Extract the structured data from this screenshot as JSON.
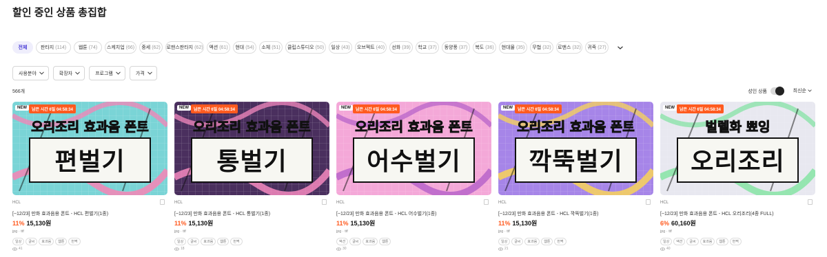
{
  "page": {
    "title": "할인 중인 상품 총집합"
  },
  "categories": [
    {
      "label": "전체",
      "count": "",
      "active": true
    },
    {
      "label": "판타지",
      "count": "(114)"
    },
    {
      "label": "웹툰",
      "count": "(74)"
    },
    {
      "label": "스케치업",
      "count": "(66)"
    },
    {
      "label": "중세",
      "count": "(62)"
    },
    {
      "label": "로맨스판타지",
      "count": "(62)"
    },
    {
      "label": "액션",
      "count": "(61)"
    },
    {
      "label": "현대",
      "count": "(54)"
    },
    {
      "label": "소체",
      "count": "(51)"
    },
    {
      "label": "클립스튜디오",
      "count": "(50)"
    },
    {
      "label": "일상",
      "count": "(43)"
    },
    {
      "label": "오브젝트",
      "count": "(40)"
    },
    {
      "label": "선화",
      "count": "(39)"
    },
    {
      "label": "학교",
      "count": "(37)"
    },
    {
      "label": "동양풍",
      "count": "(37)"
    },
    {
      "label": "복도",
      "count": "(36)"
    },
    {
      "label": "현대물",
      "count": "(35)"
    },
    {
      "label": "무협",
      "count": "(32)"
    },
    {
      "label": "로맨스",
      "count": "(32)"
    },
    {
      "label": "귀족",
      "count": "(27)"
    }
  ],
  "filters": {
    "field": "사용분야",
    "extension": "확장자",
    "program": "프로그램",
    "price": "가격"
  },
  "results": {
    "count": "566개",
    "adult_label": "성인 상품",
    "sort_label": "최신순"
  },
  "products": [
    {
      "badge_new": "NEW",
      "badge_time": "남은 시간 6일 04:58:34",
      "thumb_text": "편벌기",
      "thumb_sub": "오리조리 효과음 폰트",
      "bg": "#7ad4d6",
      "accent": "#ff7eb3",
      "brand": "HCL",
      "title": "[~12/23] 만화 효과음용 폰트 - HCL 편벌기(1종)",
      "discount": "11%",
      "price": "15,130원",
      "ext": "jpg · ttf",
      "tags": [
        "일상",
        "글씨",
        "효과음",
        "웹툰",
        "번쩍"
      ],
      "views": "41"
    },
    {
      "badge_new": "NEW",
      "badge_time": "남은 시간 6일 04:58:34",
      "thumb_text": "통벌기",
      "thumb_sub": "오리조리 효과음 폰트",
      "bg": "#4a2f5e",
      "accent": "#ff8fc4",
      "brand": "HCL",
      "title": "[~12/23] 만화 효과음용 폰트 - HCL 통벌기(1종)",
      "discount": "11%",
      "price": "15,130원",
      "ext": "jpg · ttf",
      "tags": [
        "일상",
        "글씨",
        "효과음",
        "웹툰",
        "번쩍"
      ],
      "views": "18"
    },
    {
      "badge_new": "NEW",
      "badge_time": "남은 시간 6일 04:58:34",
      "thumb_text": "어수벌기",
      "thumb_sub": "오리조리 효과음 폰트",
      "bg": "#f4a8d8",
      "accent": "#b45fc9",
      "brand": "HCL",
      "title": "[~12/23] 만화 효과음용 폰트 - HCL 어수벌기(1종)",
      "discount": "11%",
      "price": "15,130원",
      "ext": "jpg · ttf",
      "tags": [
        "액션",
        "글씨",
        "효과음",
        "웹툰"
      ],
      "views": "30"
    },
    {
      "badge_new": "NEW",
      "badge_time": "남은 시간 6일 04:58:34",
      "thumb_text": "깍뚝벌기",
      "thumb_sub": "오리조리 효과음 폰트",
      "bg": "#a685e8",
      "accent": "#ffd84d",
      "brand": "HCL",
      "title": "[~12/23] 만화 효과음용 폰트 - HCL 깍뚝벌기(1종)",
      "discount": "11%",
      "price": "15,130원",
      "ext": "jpg · ttf",
      "tags": [
        "일상",
        "글씨",
        "효과음",
        "웹툰",
        "번쩍"
      ],
      "views": "21"
    },
    {
      "badge_new": "NEW",
      "badge_time": "남은 시간 6일 04:58:34",
      "thumb_text": "오리조리",
      "thumb_sub": "벌렐화 뾰잉",
      "bg": "#e8e8f0",
      "accent": "#7fe3a0",
      "brand": "HCL",
      "title": "[~12/23] 만화 효과음용 폰트 - HCL 오리조리(4종 FULL)",
      "discount": "6%",
      "price": "60,160원",
      "ext": "jpg · ttf",
      "tags": [
        "일상",
        "액션",
        "글씨",
        "효과음",
        "웹툰",
        "번쩍"
      ],
      "views": "40"
    }
  ]
}
